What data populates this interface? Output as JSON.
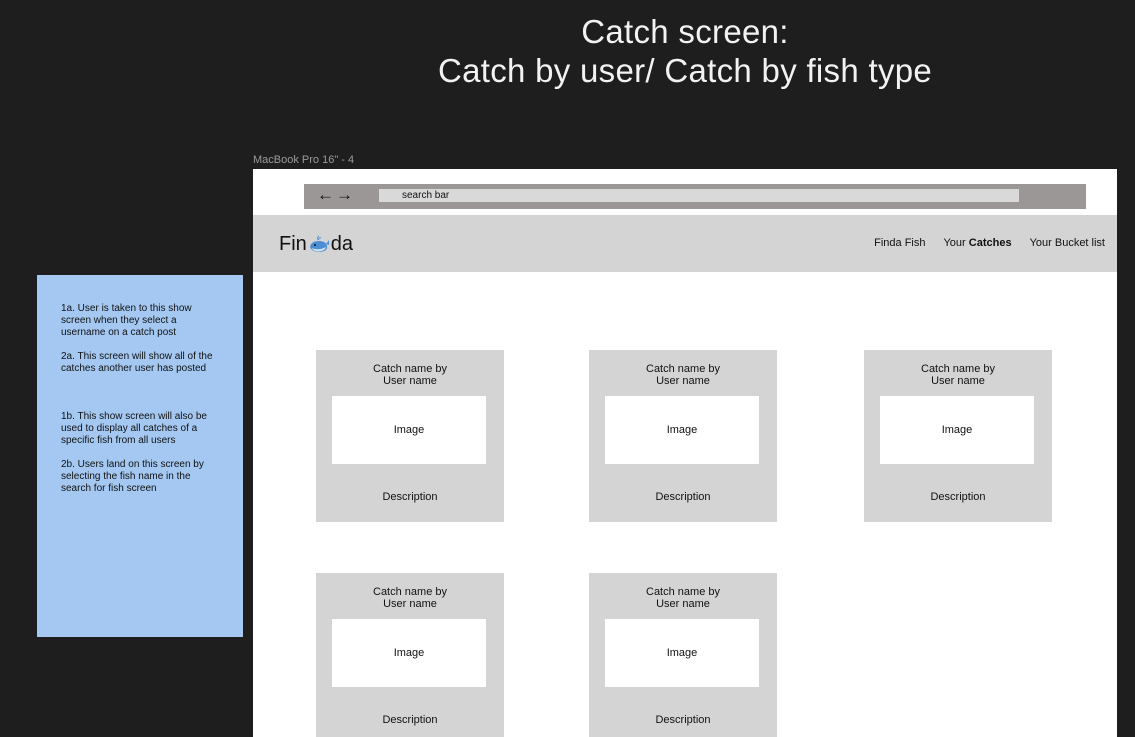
{
  "heading": {
    "line1": "Catch screen:",
    "line2": "Catch by user/ Catch by fish type"
  },
  "frame_label": "MacBook Pro 16\" - 4",
  "notes": [
    "1a. User is taken to this show screen when they select a username on a catch post",
    "2a. This screen will show all of the catches another user has posted",
    "1b. This show screen will also be used to display all catches of a specific fish from all users",
    "2b. Users land on this screen by selecting the fish name in the search for fish screen"
  ],
  "browser": {
    "back": "←",
    "forward": "→",
    "search": "search bar"
  },
  "logo": {
    "left": "Fin",
    "icon": "whale-icon",
    "right": "da"
  },
  "nav": {
    "finda_fish": "Finda Fish",
    "your_prefix": "Your",
    "catches": "Catches",
    "bucket_list": "Your Bucket list"
  },
  "cards": [
    {
      "title1": "Catch name by",
      "title2": "User name",
      "image": "Image",
      "description": "Description"
    },
    {
      "title1": "Catch name by",
      "title2": "User name",
      "image": "Image",
      "description": "Description"
    },
    {
      "title1": "Catch name by",
      "title2": "User name",
      "image": "Image",
      "description": "Description"
    },
    {
      "title1": "Catch name by",
      "title2": "User name",
      "image": "Image",
      "description": "Description"
    },
    {
      "title1": "Catch name by",
      "title2": "User name",
      "image": "Image",
      "description": "Description"
    }
  ],
  "colors": {
    "canvas": "#1e1e1e",
    "note": "#a4c8f2",
    "navbar": "#d4d4d4",
    "browser_bar": "#9c9797",
    "card": "#d4d4d4"
  }
}
